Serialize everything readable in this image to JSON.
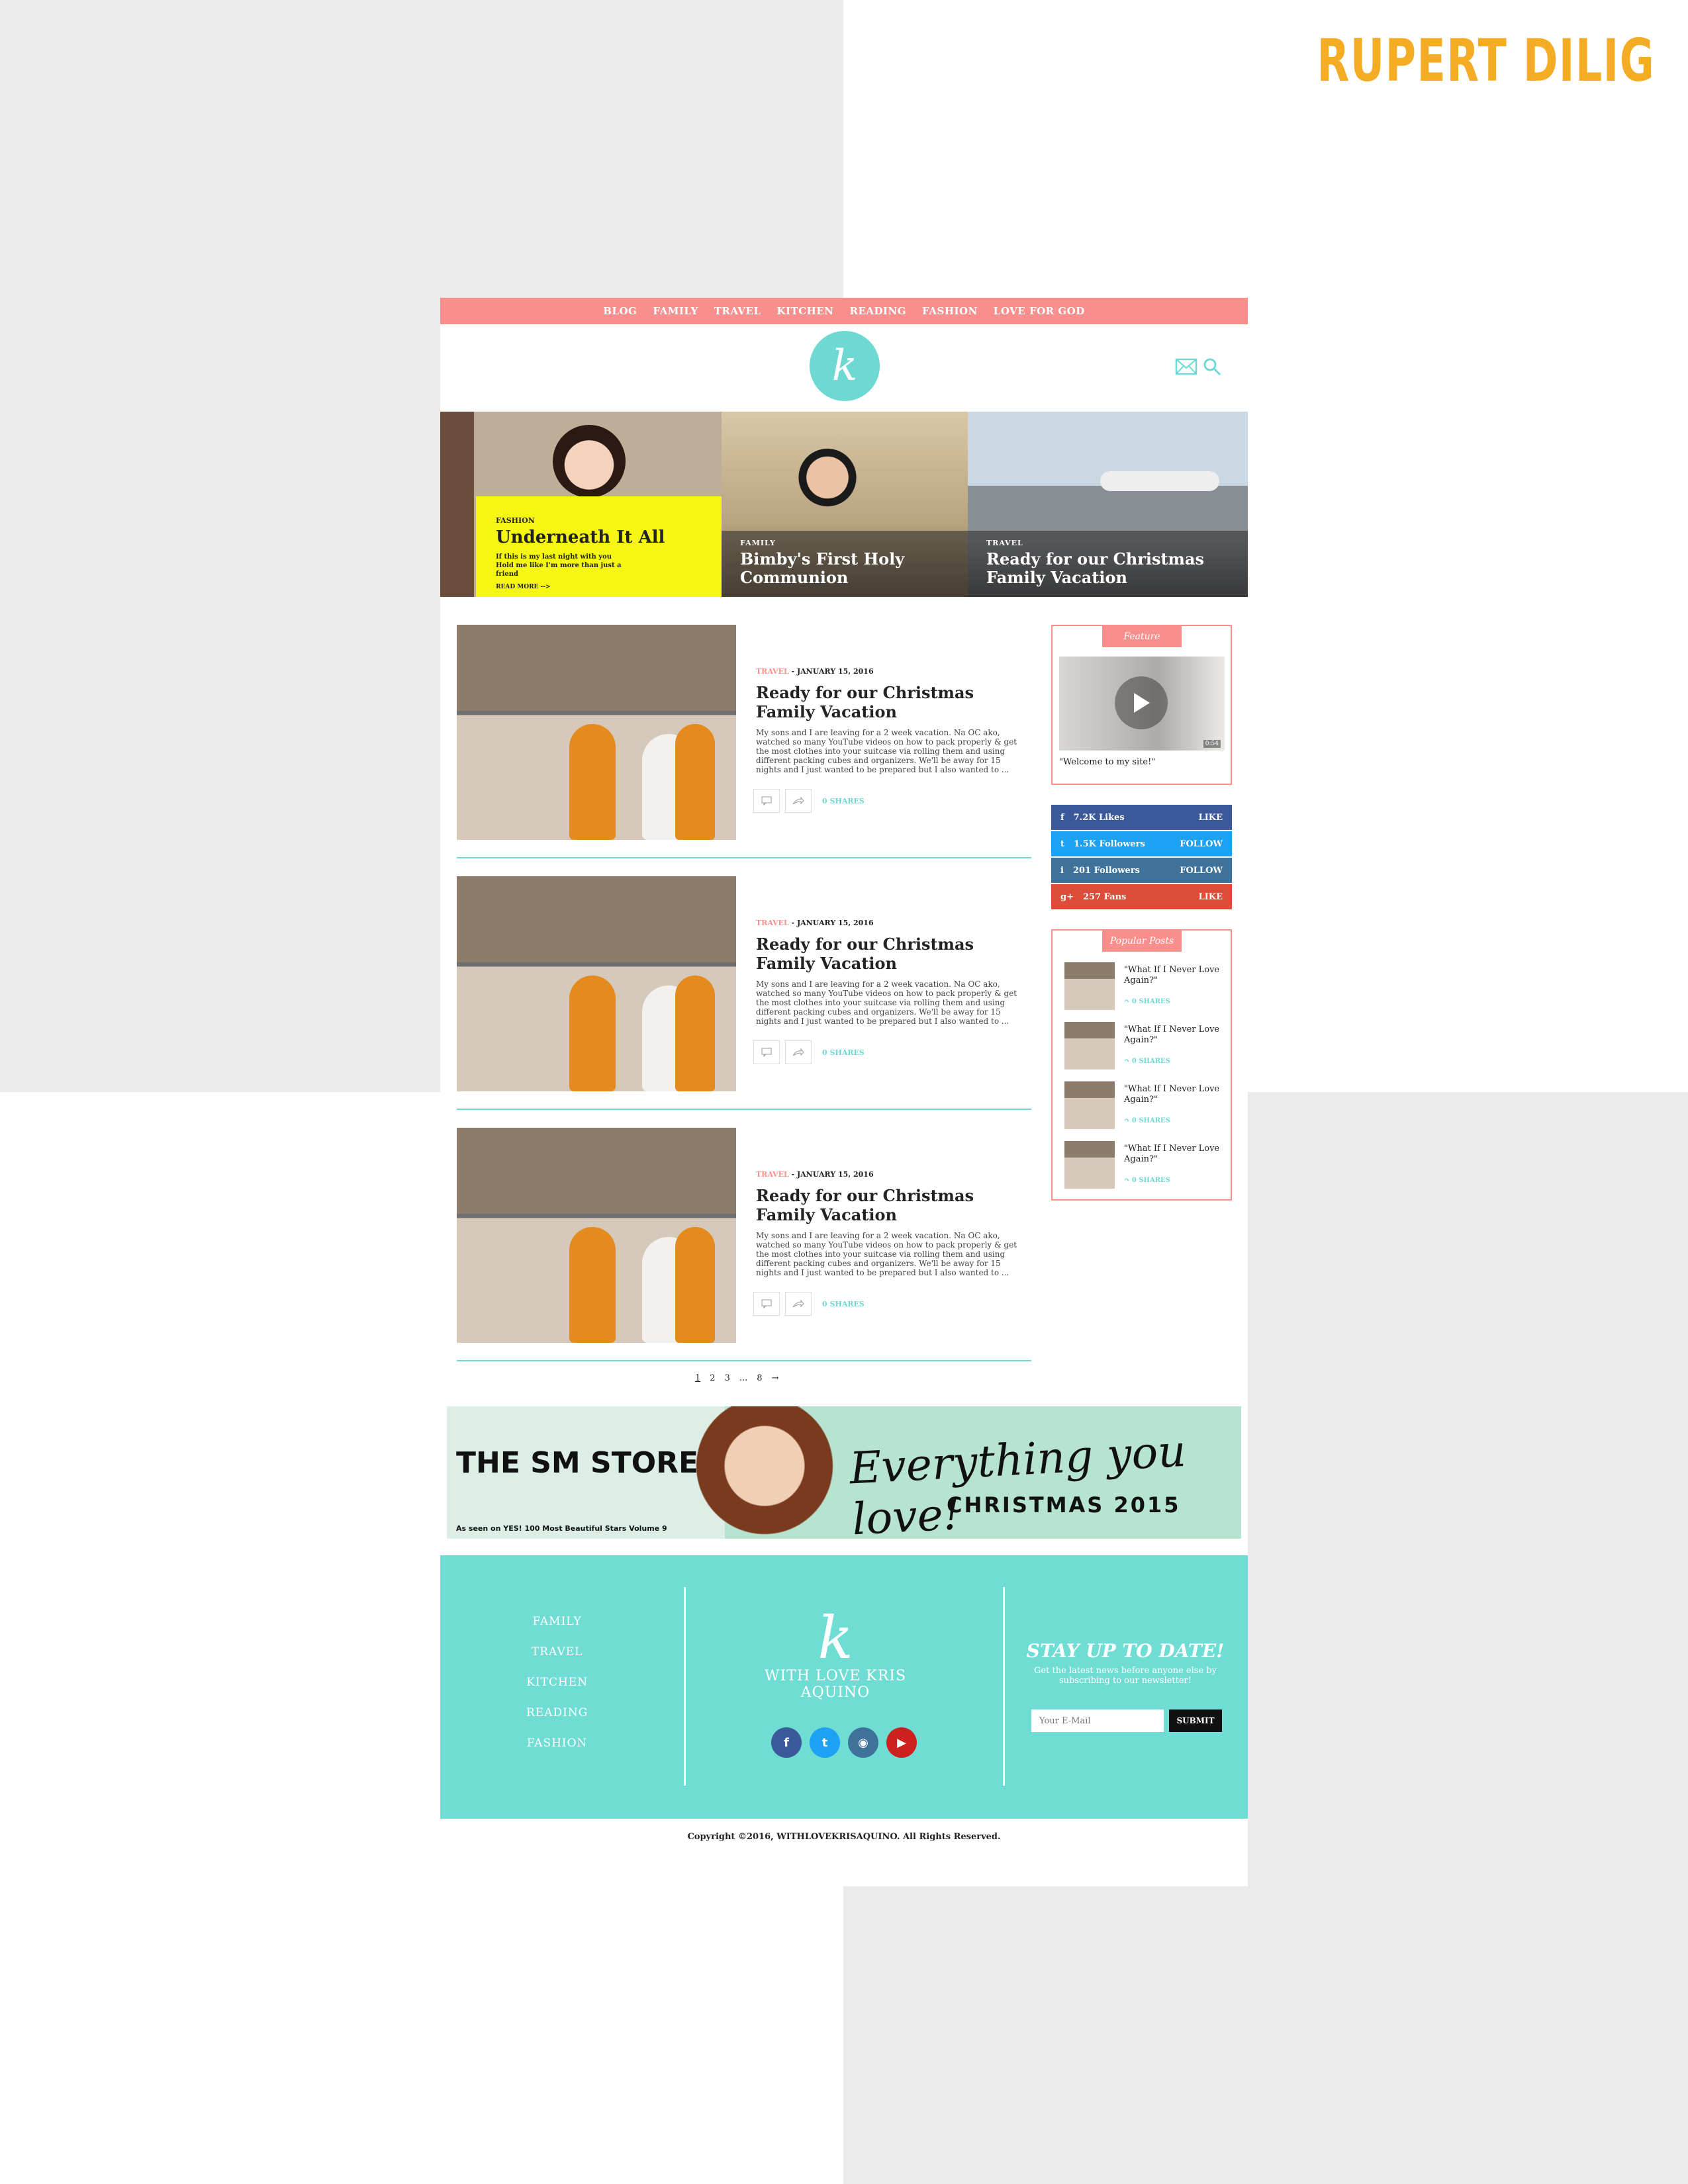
{
  "designer": "RUPERT DILIG",
  "nav": [
    "BLOG",
    "FAMILY",
    "TRAVEL",
    "KITCHEN",
    "READING",
    "FASHION",
    "LOVE FOR GOD"
  ],
  "logo_letter": "k",
  "hero": [
    {
      "category": "FASHION",
      "title": "Underneath It All",
      "subtitle": "If this is my last night with you Hold me like I'm more than just a friend",
      "read_more": "READ MORE -->"
    },
    {
      "category": "FAMILY",
      "title": "Bimby's First Holy Communion"
    },
    {
      "category": "TRAVEL",
      "title": "Ready for our Christmas Family Vacation"
    }
  ],
  "posts": [
    {
      "category": "TRAVEL",
      "date": " - JANUARY 15, 2016",
      "title": "Ready for our Christmas Family Vacation",
      "excerpt": "My sons and I are leaving for a 2 week vacation. Na OC ako, watched so many YouTube videos on how to pack properly & get the most clothes into your suitcase via rolling them and using different packing cubes and organizers. We'll be away for 15 nights and I just wanted to be prepared but I also wanted to ...",
      "shares": "0 SHARES"
    },
    {
      "category": "TRAVEL",
      "date": " - JANUARY 15, 2016",
      "title": "Ready for our Christmas Family Vacation",
      "excerpt": "My sons and I are leaving for a 2 week vacation. Na OC ako, watched so many YouTube videos on how to pack properly & get the most clothes into your suitcase via rolling them and using different packing cubes and organizers. We'll be away for 15 nights and I just wanted to be prepared but I also wanted to ...",
      "shares": "0 SHARES"
    },
    {
      "category": "TRAVEL",
      "date": " - JANUARY 15, 2016",
      "title": "Ready for our Christmas Family Vacation",
      "excerpt": "My sons and I are leaving for a 2 week vacation. Na OC ako, watched so many YouTube videos on how to pack properly & get the most clothes into your suitcase via rolling them and using different packing cubes and organizers. We'll be away for 15 nights and I just wanted to be prepared but I also wanted to ...",
      "shares": "0 SHARES"
    }
  ],
  "pagination": [
    "1",
    "2",
    "3",
    "...",
    "8",
    "→"
  ],
  "feature": {
    "header": "Feature",
    "quote": "\"Welcome to my site!\"",
    "duration": "0:54"
  },
  "social": [
    {
      "icon": "f",
      "label": "7.2K Likes",
      "action": "LIKE",
      "color": "#3b5998"
    },
    {
      "icon": "t",
      "label": "1.5K Followers",
      "action": "FOLLOW",
      "color": "#1da1f2"
    },
    {
      "icon": "i",
      "label": "201 Followers",
      "action": "FOLLOW",
      "color": "#3f729b"
    },
    {
      "icon": "g+",
      "label": "257 Fans",
      "action": "LIKE",
      "color": "#dd4b39"
    }
  ],
  "popular": {
    "header": "Popular Posts",
    "items": [
      {
        "title": "\"What If I Never Love Again?\"",
        "shares": "0 SHARES"
      },
      {
        "title": "\"What If I Never Love Again?\"",
        "shares": "0 SHARES"
      },
      {
        "title": "\"What If I Never Love Again?\"",
        "shares": "0 SHARES"
      },
      {
        "title": "\"What If I Never Love Again?\"",
        "shares": "0 SHARES"
      }
    ]
  },
  "banner": {
    "brand": "THE SM STORE",
    "note": "As seen on YES! 100 Most Beautiful Stars Volume 9",
    "tagline": "Everything you love!",
    "season": "CHRISTMAS 2015"
  },
  "footer": {
    "nav": [
      "FAMILY",
      "TRAVEL",
      "KITCHEN",
      "READING",
      "FASHION"
    ],
    "site_name": "WITH LOVE KRIS AQUINO",
    "newsletter_title": "STAY UP TO DATE!",
    "newsletter_desc": "Get the latest news before anyone else by subscribing to our newsletter!",
    "email_placeholder": "Your E-Mail",
    "submit": "SUBMIT"
  },
  "copyright": "Copyright ©2016, WITHLOVEKRISAQUINO. All Rights Reserved."
}
